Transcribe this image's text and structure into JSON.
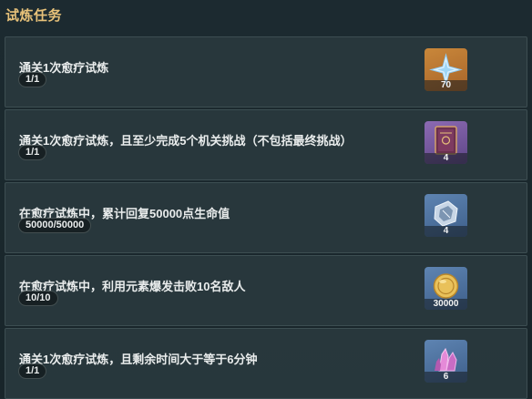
{
  "header": {
    "title": "试炼任务"
  },
  "tasks": [
    {
      "title": "通关1次愈疗试炼",
      "progress": "1/1",
      "reward": {
        "icon": "primogem-icon",
        "count": "70"
      }
    },
    {
      "title": "通关1次愈疗试炼，且至少完成5个机关挑战（不包括最终挑战）",
      "progress": "1/1",
      "reward": {
        "icon": "heros-wit-book-icon",
        "count": "4"
      }
    },
    {
      "title": "在愈疗试炼中，累计回复50000点生命值",
      "progress": "50000/50000",
      "reward": {
        "icon": "mystic-enhancement-ore-icon",
        "count": "4"
      }
    },
    {
      "title": "在愈疗试炼中，利用元素爆发击败10名敌人",
      "progress": "10/10",
      "reward": {
        "icon": "mora-icon",
        "count": "30000"
      }
    },
    {
      "title": "通关1次愈疗试炼，且剩余时间大于等于6分钟",
      "progress": "1/1",
      "reward": {
        "icon": "crystal-chunk-icon",
        "count": "6"
      }
    }
  ],
  "colors": {
    "header_title": "#e8c27a",
    "card_bg": "#29383e",
    "reward_orange": "#c9873a",
    "reward_purple": "#8c6ab3",
    "reward_blue": "#5e84b2"
  }
}
